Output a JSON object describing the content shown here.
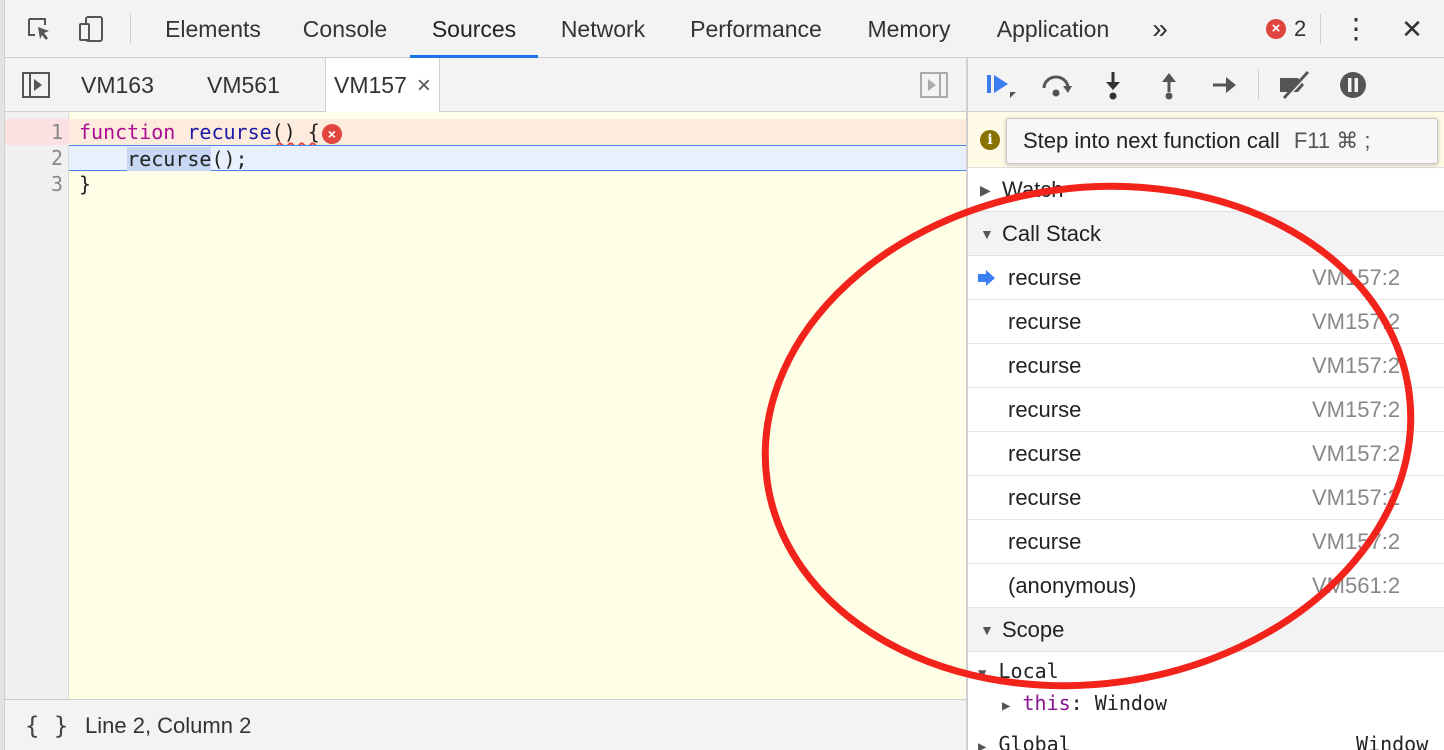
{
  "toolbar": {
    "tabs": [
      "Elements",
      "Console",
      "Sources",
      "Network",
      "Performance",
      "Memory",
      "Application"
    ],
    "active_tab": "Sources",
    "more_tabs_glyph": "»",
    "error_count": "2",
    "error_glyph": "×",
    "kebab_glyph": "⋮",
    "close_glyph": "✕"
  },
  "file_tabs": [
    "VM163",
    "VM561",
    "VM157"
  ],
  "active_file_tab_close": "×",
  "editor": {
    "line_numbers": [
      "1",
      "2",
      "3"
    ],
    "line1": {
      "keyword": "function",
      "space1": " ",
      "name": "recurse",
      "rest": "() {"
    },
    "line2": {
      "indent": "    ",
      "call": "recurse",
      "rest": "();"
    },
    "line3": "}",
    "error_glyph": "×"
  },
  "status_bar": {
    "braces": "{ }",
    "position": "Line 2, Column 2"
  },
  "debugger": {
    "hint_icon": "i",
    "tooltip": {
      "text": "Step into next function call",
      "keys": "F11  ⌘ ;"
    },
    "watch_label": "Watch",
    "call_stack_label": "Call Stack",
    "call_stack": [
      {
        "fn": "recurse",
        "loc": "VM157:2"
      },
      {
        "fn": "recurse",
        "loc": "VM157:2"
      },
      {
        "fn": "recurse",
        "loc": "VM157:2"
      },
      {
        "fn": "recurse",
        "loc": "VM157:2"
      },
      {
        "fn": "recurse",
        "loc": "VM157:2"
      },
      {
        "fn": "recurse",
        "loc": "VM157:2"
      },
      {
        "fn": "recurse",
        "loc": "VM157:2"
      },
      {
        "fn": "(anonymous)",
        "loc": "VM561:2"
      }
    ],
    "scope_label": "Scope",
    "local_label": "Local",
    "this_key": "this",
    "this_sep": ": ",
    "this_value": "Window",
    "global_label": "Global",
    "global_value": "Window"
  },
  "colors": {
    "accent": "#1a73e8",
    "error": "#e1453f",
    "annotation": "#f2231b"
  }
}
